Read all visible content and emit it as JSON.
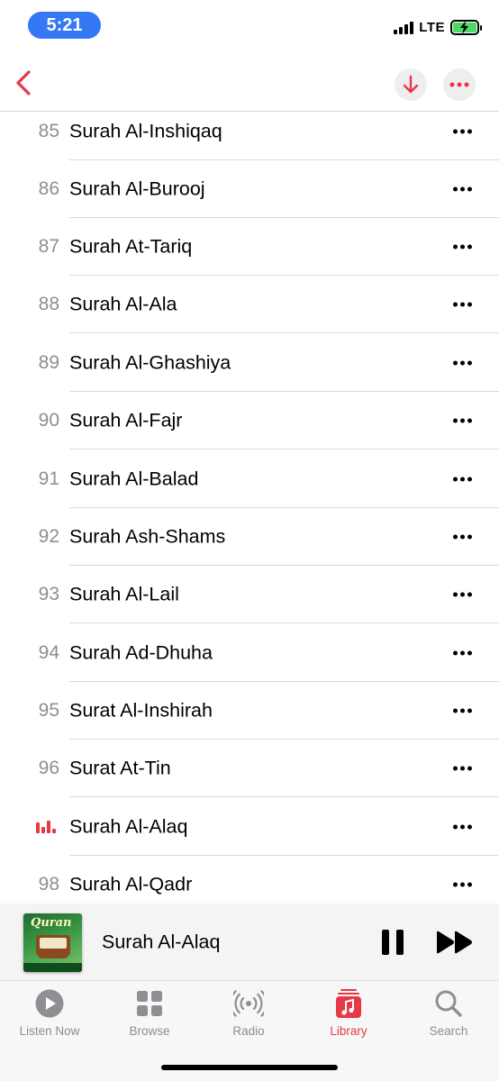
{
  "status_bar": {
    "time": "5:21",
    "network": "LTE"
  },
  "colors": {
    "accent": "#e53947",
    "time_pill": "#3478f6",
    "battery": "#4cd964"
  },
  "nav": {
    "back_icon": "chevron-left-icon",
    "download_icon": "download-arrow-icon",
    "more_icon": "ellipsis-icon"
  },
  "tracks": [
    {
      "number": "85",
      "title": "Surah Al-Inshiqaq"
    },
    {
      "number": "86",
      "title": "Surah Al-Burooj"
    },
    {
      "number": "87",
      "title": "Surah At-Tariq"
    },
    {
      "number": "88",
      "title": "Surah Al-Ala"
    },
    {
      "number": "89",
      "title": "Surah Al-Ghashiya"
    },
    {
      "number": "90",
      "title": "Surah Al-Fajr"
    },
    {
      "number": "91",
      "title": "Surah Al-Balad"
    },
    {
      "number": "92",
      "title": "Surah Ash-Shams"
    },
    {
      "number": "93",
      "title": "Surah Al-Lail"
    },
    {
      "number": "94",
      "title": "Surah Ad-Dhuha"
    },
    {
      "number": "95",
      "title": "Surat Al-Inshirah"
    },
    {
      "number": "96",
      "title": "Surat At-Tin"
    },
    {
      "number": "",
      "title": "Surah Al-Alaq",
      "playing": true
    },
    {
      "number": "98",
      "title": "Surah Al-Qadr"
    }
  ],
  "mini_player": {
    "title": "Surah Al-Alaq",
    "artwork_text": "Quran",
    "pause_icon": "pause-icon",
    "forward_icon": "fast-forward-icon"
  },
  "tabs": [
    {
      "label": "Listen Now",
      "icon": "play-circle-icon"
    },
    {
      "label": "Browse",
      "icon": "grid-icon"
    },
    {
      "label": "Radio",
      "icon": "radio-waves-icon"
    },
    {
      "label": "Library",
      "icon": "music-library-icon",
      "active": true
    },
    {
      "label": "Search",
      "icon": "search-icon"
    }
  ]
}
